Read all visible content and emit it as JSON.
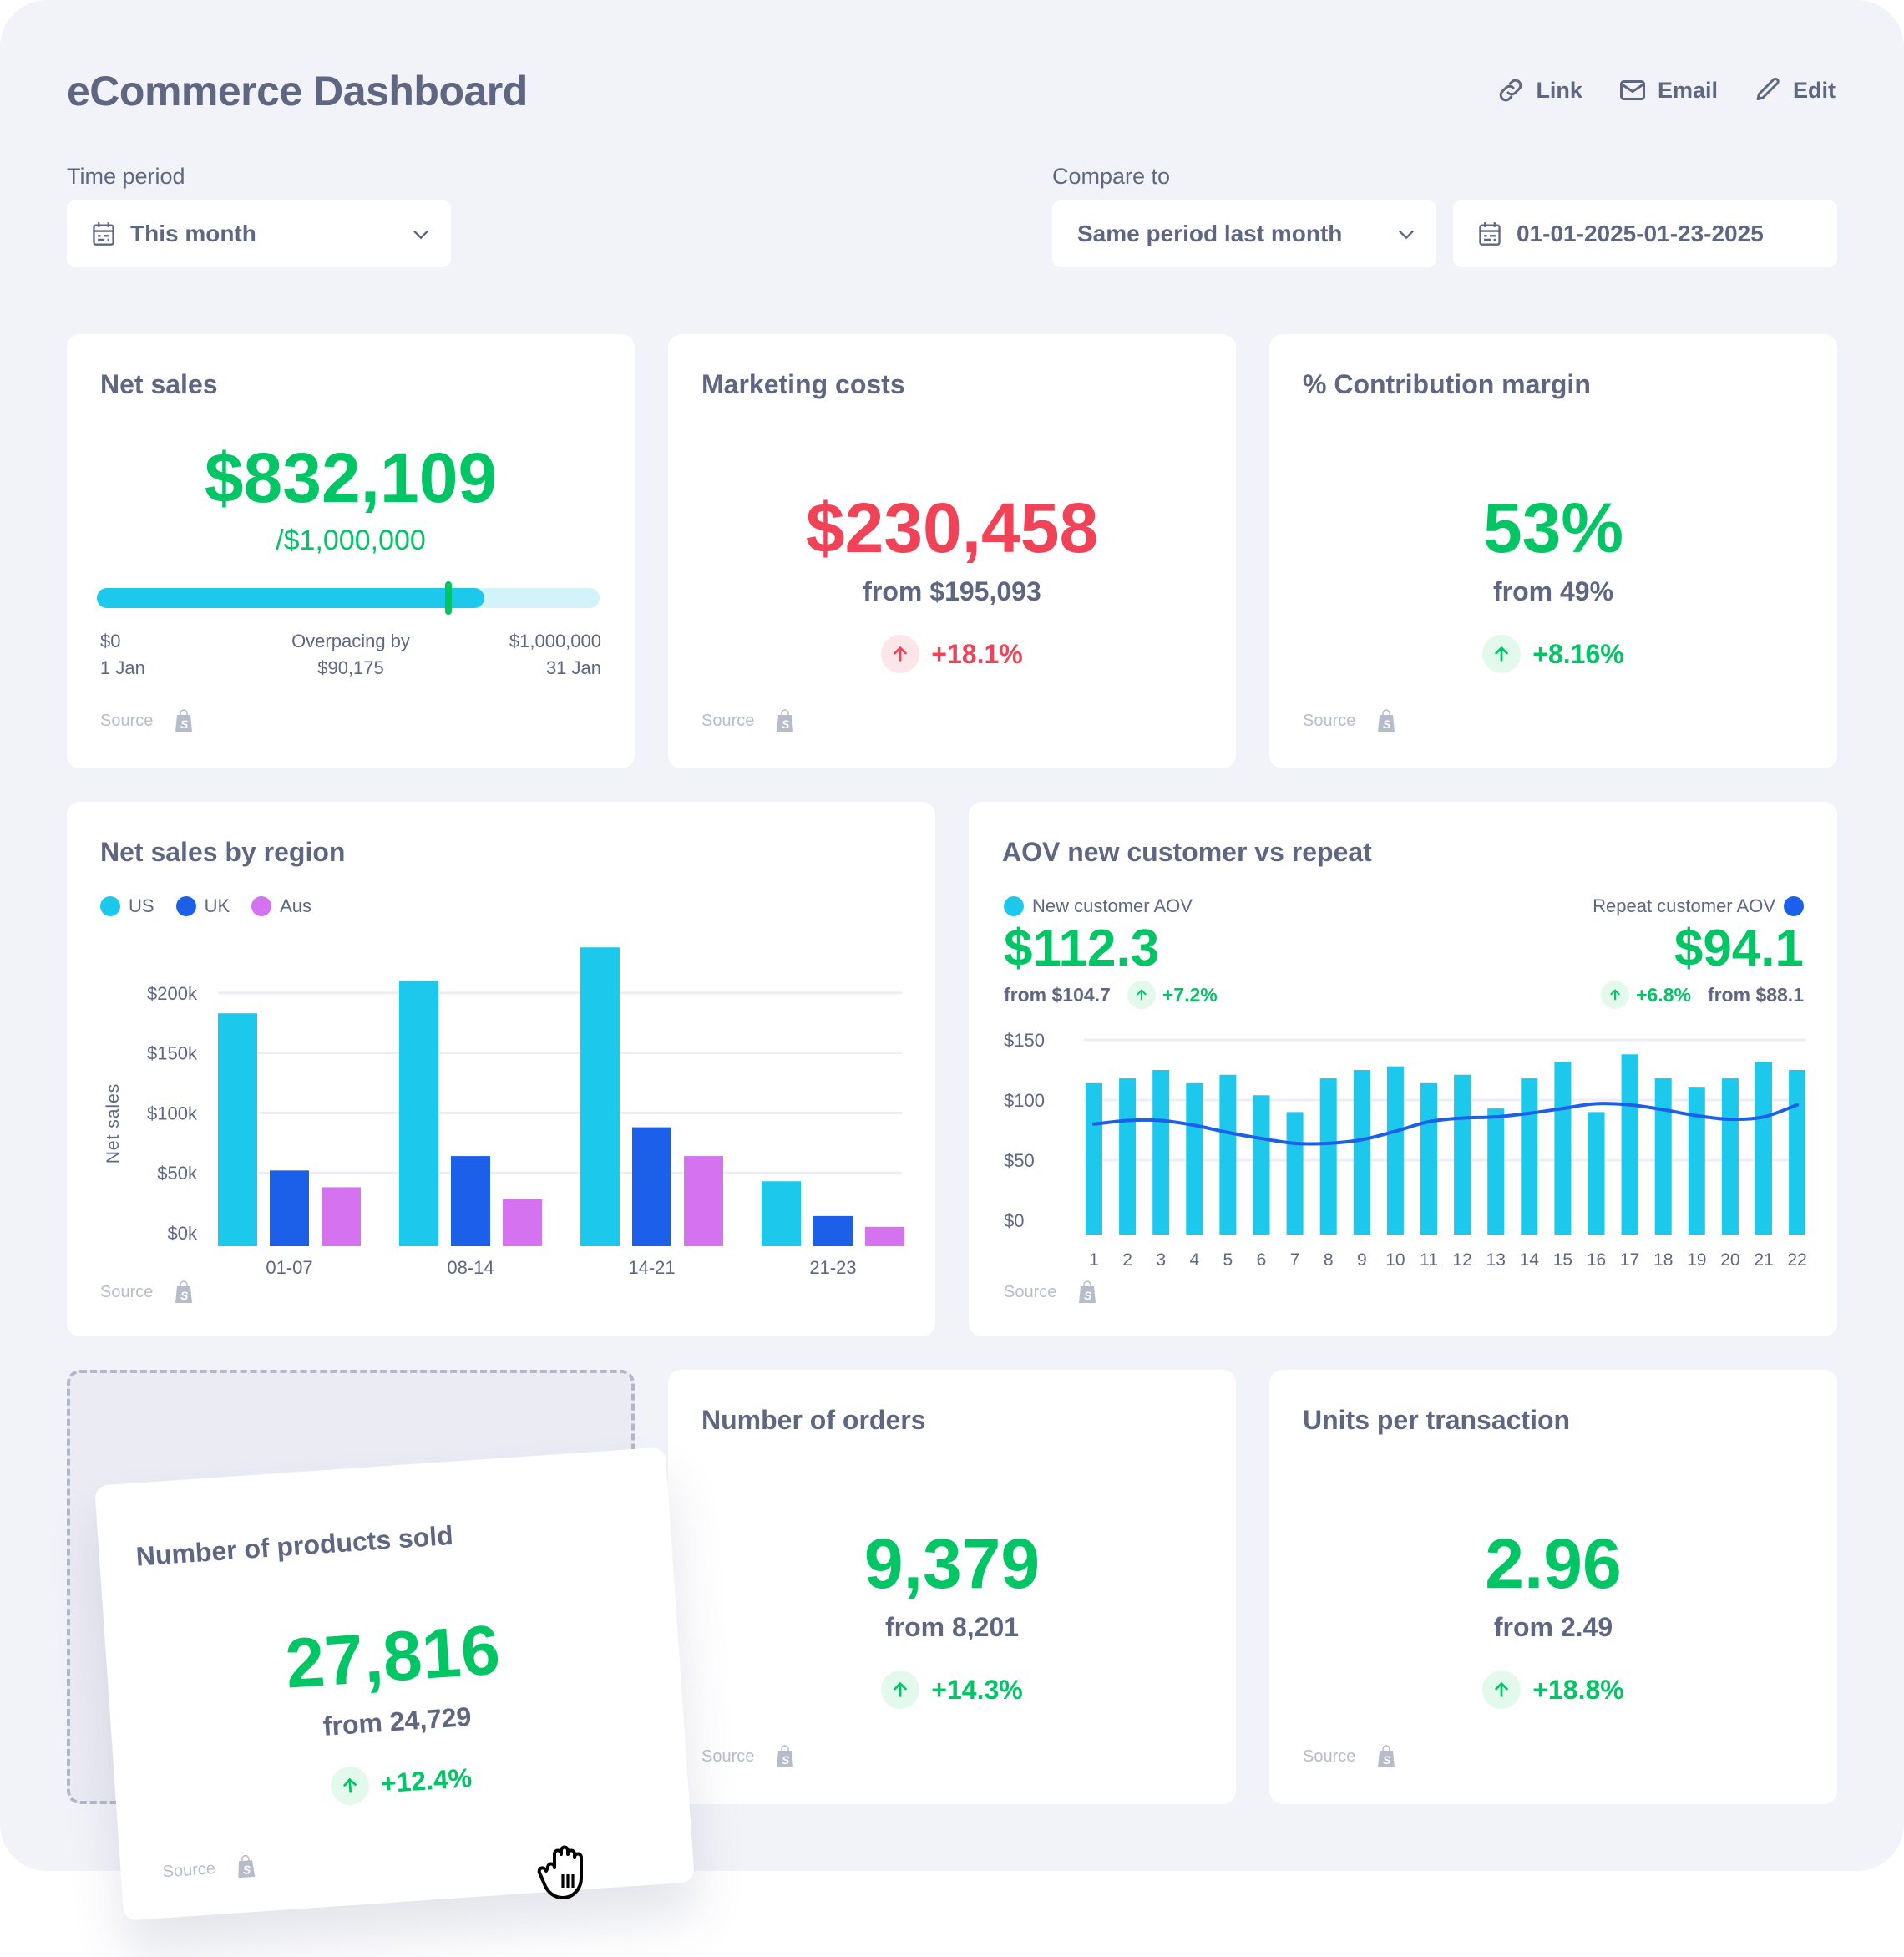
{
  "header": {
    "title": "eCommerce Dashboard",
    "actions": [
      {
        "label": "Link",
        "icon": "link-icon"
      },
      {
        "label": "Email",
        "icon": "mail-icon"
      },
      {
        "label": "Edit",
        "icon": "pencil-icon"
      }
    ]
  },
  "filters": {
    "time_period_label": "Time period",
    "time_period_value": "This month",
    "compare_label": "Compare to",
    "compare_value": "Same period last month",
    "date_range": "01-01-2025-01-23-2025"
  },
  "colors": {
    "green": "#00c565",
    "red": "#f04358",
    "us": "#1cc8ec",
    "uk": "#1c60ea",
    "aus": "#d472f0",
    "text": "#5f6682"
  },
  "source_label": "Source",
  "net_sales": {
    "title": "Net sales",
    "value": "$832,109",
    "target": "/$1,000,000",
    "progress_fill": 0.77,
    "pace_marker": 0.7,
    "start_amount": "$0",
    "start_date": "1 Jan",
    "mid_line1": "Overpacing by",
    "mid_line2": "$90,175",
    "end_amount": "$1,000,000",
    "end_date": "31 Jan"
  },
  "marketing_costs": {
    "title": "Marketing costs",
    "value": "$230,458",
    "from": "from $195,093",
    "delta": "+18.1%",
    "trend": "up-bad"
  },
  "contribution_margin": {
    "title": "% Contribution margin",
    "value": "53%",
    "from": "from 49%",
    "delta": "+8.16%",
    "trend": "up-good"
  },
  "products_sold": {
    "title": "Number of products sold",
    "value": "27,816",
    "from": "from 24,729",
    "delta": "+12.4%",
    "trend": "up-good"
  },
  "orders": {
    "title": "Number of orders",
    "value": "9,379",
    "from": "from 8,201",
    "delta": "+14.3%",
    "trend": "up-good"
  },
  "units_per_transaction": {
    "title": "Units per transaction",
    "value": "2.96",
    "from": "from 2.49",
    "delta": "+18.8%",
    "trend": "up-good"
  },
  "aov": {
    "title": "AOV new customer vs repeat",
    "new_label": "New customer AOV",
    "new_value": "$112.3",
    "new_from": "from $104.7",
    "new_delta": "+7.2%",
    "repeat_label": "Repeat customer AOV",
    "repeat_value": "$94.1",
    "repeat_from": "from $88.1",
    "repeat_delta": "+6.8%"
  },
  "chart_data": [
    {
      "type": "bar",
      "title": "Net sales by region",
      "xlabel": "",
      "ylabel": "Net sales",
      "categories": [
        "01-07",
        "08-14",
        "14-21",
        "21-23"
      ],
      "series": [
        {
          "name": "US",
          "values": [
            183,
            210,
            238,
            43
          ]
        },
        {
          "name": "UK",
          "values": [
            52,
            64,
            88,
            14
          ]
        },
        {
          "name": "Aus",
          "values": [
            38,
            28,
            64,
            5
          ]
        }
      ],
      "units": "thousands USD",
      "yticks": [
        "$0k",
        "$50k",
        "$100k",
        "$150k",
        "$200k"
      ],
      "ytick_values": [
        0,
        50,
        100,
        150,
        200
      ],
      "ylim": [
        0,
        250
      ],
      "grid": true,
      "legend": "top-left"
    },
    {
      "type": "bar",
      "title": "AOV new customer vs repeat",
      "xlabel": "",
      "ylabel": "",
      "categories": [
        "1",
        "2",
        "3",
        "4",
        "5",
        "6",
        "7",
        "8",
        "9",
        "10",
        "11",
        "12",
        "13",
        "14",
        "15",
        "16",
        "17",
        "18",
        "19",
        "20",
        "21",
        "22"
      ],
      "series": [
        {
          "name": "New customer AOV",
          "kind": "bar",
          "values": [
            114,
            118,
            125,
            114,
            121,
            104,
            90,
            118,
            125,
            128,
            114,
            121,
            93,
            118,
            132,
            90,
            138,
            118,
            111,
            118,
            132,
            125
          ]
        },
        {
          "name": "Repeat customer AOV",
          "kind": "line",
          "values": [
            80,
            83,
            83,
            79,
            73,
            68,
            64,
            64,
            67,
            74,
            82,
            85,
            86,
            89,
            93,
            97,
            96,
            92,
            87,
            84,
            86,
            96
          ]
        }
      ],
      "yticks": [
        "$0",
        "$50",
        "$100",
        "$150"
      ],
      "ytick_values": [
        0,
        50,
        100,
        150
      ],
      "ylim": [
        0,
        150
      ],
      "grid": true,
      "legend": "top (left: new, right: repeat)"
    }
  ]
}
